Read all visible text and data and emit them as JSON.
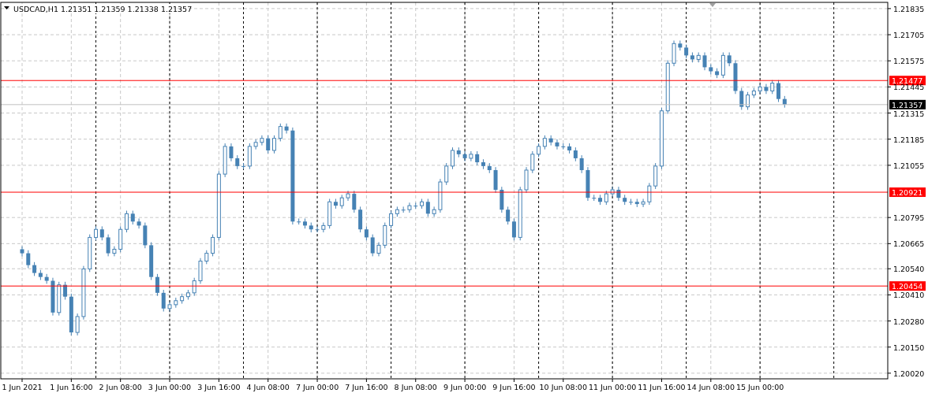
{
  "header": {
    "quotes": [
      "1.21351",
      "1.21359",
      "1.21338",
      "1.21357"
    ]
  },
  "chart_data": {
    "type": "candlestick",
    "grid": true,
    "title": "USDCAD,H1",
    "categories": [
      "1 Jun 2021",
      null,
      null,
      null,
      null,
      null,
      null,
      null,
      "1 Jun 16:00",
      null,
      null,
      null,
      null,
      null,
      null,
      null,
      "2 Jun 08:00",
      null,
      null,
      null,
      null,
      null,
      null,
      null,
      "3 Jun 00:00",
      null,
      null,
      null,
      null,
      null,
      null,
      null,
      "3 Jun 16:00",
      null,
      null,
      null,
      null,
      null,
      null,
      null,
      "4 Jun 08:00",
      null,
      null,
      null,
      null,
      null,
      null,
      null,
      "7 Jun 00:00",
      null,
      null,
      null,
      null,
      null,
      null,
      null,
      "7 Jun 16:00",
      null,
      null,
      null,
      null,
      null,
      null,
      null,
      "8 Jun 08:00",
      null,
      null,
      null,
      null,
      null,
      null,
      null,
      "9 Jun 00:00",
      null,
      null,
      null,
      null,
      null,
      null,
      null,
      "9 Jun 16:00",
      null,
      null,
      null,
      null,
      null,
      null,
      null,
      "10 Jun 08:00",
      null,
      null,
      null,
      null,
      null,
      null,
      null,
      "11 Jun 00:00",
      null,
      null,
      null,
      null,
      null,
      null,
      null,
      "11 Jun 16:00",
      null,
      null,
      null,
      null,
      null,
      null,
      null,
      "14 Jun 08:00",
      null,
      null,
      null,
      null,
      null,
      null,
      null,
      "15 Jun 00:00",
      null,
      null,
      null,
      null,
      null,
      null,
      null,
      null,
      null,
      null,
      null,
      null,
      null,
      null,
      null,
      null,
      null,
      null,
      null,
      null
    ],
    "ohlc": [
      [
        1.20637,
        1.20652,
        1.20602,
        1.20617
      ],
      [
        1.20617,
        1.20632,
        1.20543,
        1.20558
      ],
      [
        1.20558,
        1.20573,
        1.20504,
        1.20519
      ],
      [
        1.20519,
        1.20534,
        1.20484,
        1.20499
      ],
      [
        1.20499,
        1.20514,
        1.20465,
        1.2048
      ],
      [
        1.2048,
        1.20495,
        1.20307,
        1.20322
      ],
      [
        1.20322,
        1.20475,
        1.20307,
        1.2046
      ],
      [
        1.2046,
        1.20475,
        1.20386,
        1.20401
      ],
      [
        1.20401,
        1.20416,
        1.20208,
        1.20223
      ],
      [
        1.20223,
        1.20317,
        1.20208,
        1.20302
      ],
      [
        1.20302,
        1.20554,
        1.20287,
        1.20539
      ],
      [
        1.20539,
        1.20711,
        1.20524,
        1.20696
      ],
      [
        1.20696,
        1.20751,
        1.20681,
        1.20736
      ],
      [
        1.20736,
        1.20751,
        1.20681,
        1.20696
      ],
      [
        1.20696,
        1.20711,
        1.20602,
        1.20617
      ],
      [
        1.20617,
        1.20652,
        1.20602,
        1.20637
      ],
      [
        1.20637,
        1.20751,
        1.20622,
        1.20736
      ],
      [
        1.20736,
        1.20829,
        1.20721,
        1.20814
      ],
      [
        1.20814,
        1.20829,
        1.2076,
        1.20775
      ],
      [
        1.20775,
        1.2079,
        1.2074,
        1.20755
      ],
      [
        1.20755,
        1.2077,
        1.20642,
        1.20657
      ],
      [
        1.20657,
        1.20672,
        1.20484,
        1.20499
      ],
      [
        1.20499,
        1.20514,
        1.20405,
        1.2042
      ],
      [
        1.2042,
        1.20435,
        1.20327,
        1.20342
      ],
      [
        1.20342,
        1.20376,
        1.20327,
        1.20361
      ],
      [
        1.20361,
        1.20396,
        1.20346,
        1.20381
      ],
      [
        1.20381,
        1.20416,
        1.20366,
        1.20401
      ],
      [
        1.20401,
        1.20435,
        1.20386,
        1.2042
      ],
      [
        1.2042,
        1.20495,
        1.20405,
        1.2048
      ],
      [
        1.2048,
        1.20593,
        1.20465,
        1.20578
      ],
      [
        1.20578,
        1.20632,
        1.20563,
        1.20617
      ],
      [
        1.20617,
        1.20711,
        1.20602,
        1.20696
      ],
      [
        1.20696,
        1.21026,
        1.20681,
        1.21011
      ],
      [
        1.21011,
        1.21164,
        1.20996,
        1.21149
      ],
      [
        1.21149,
        1.21164,
        1.21075,
        1.2109
      ],
      [
        1.2109,
        1.21105,
        1.21036,
        1.21051
      ],
      [
        1.21051,
        1.21066,
        1.21036,
        1.21051
      ],
      [
        1.21051,
        1.21164,
        1.21036,
        1.21149
      ],
      [
        1.21149,
        1.21184,
        1.21134,
        1.21169
      ],
      [
        1.21169,
        1.21204,
        1.21154,
        1.21189
      ],
      [
        1.21189,
        1.21204,
        1.21114,
        1.21129
      ],
      [
        1.21129,
        1.21204,
        1.21114,
        1.21189
      ],
      [
        1.21189,
        1.21263,
        1.21174,
        1.21248
      ],
      [
        1.21248,
        1.21263,
        1.21213,
        1.21228
      ],
      [
        1.21228,
        1.21243,
        1.2076,
        1.20775
      ],
      [
        1.20775,
        1.2079,
        1.2076,
        1.20775
      ],
      [
        1.20775,
        1.2079,
        1.2074,
        1.20755
      ],
      [
        1.20755,
        1.2077,
        1.20721,
        1.20736
      ],
      [
        1.20736,
        1.20751,
        1.20721,
        1.20736
      ],
      [
        1.20736,
        1.2077,
        1.20721,
        1.20755
      ],
      [
        1.20755,
        1.20888,
        1.2074,
        1.20873
      ],
      [
        1.20873,
        1.20888,
        1.20839,
        1.20854
      ],
      [
        1.20854,
        1.20908,
        1.20839,
        1.20893
      ],
      [
        1.20893,
        1.20928,
        1.20878,
        1.20913
      ],
      [
        1.20913,
        1.20928,
        1.20819,
        1.20834
      ],
      [
        1.20834,
        1.20849,
        1.20721,
        1.20736
      ],
      [
        1.20736,
        1.20751,
        1.20681,
        1.20696
      ],
      [
        1.20696,
        1.20711,
        1.20602,
        1.20617
      ],
      [
        1.20617,
        1.20672,
        1.20602,
        1.20657
      ],
      [
        1.20657,
        1.2077,
        1.20642,
        1.20755
      ],
      [
        1.20755,
        1.20829,
        1.2074,
        1.20814
      ],
      [
        1.20814,
        1.20849,
        1.20799,
        1.20834
      ],
      [
        1.20834,
        1.20849,
        1.20819,
        1.20834
      ],
      [
        1.20834,
        1.20869,
        1.20819,
        1.20854
      ],
      [
        1.20854,
        1.20869,
        1.20839,
        1.20854
      ],
      [
        1.20854,
        1.20888,
        1.20839,
        1.20873
      ],
      [
        1.20873,
        1.20888,
        1.20799,
        1.20814
      ],
      [
        1.20814,
        1.20849,
        1.20799,
        1.20834
      ],
      [
        1.20834,
        1.20987,
        1.20819,
        1.20972
      ],
      [
        1.20972,
        1.21066,
        1.20957,
        1.21051
      ],
      [
        1.21051,
        1.21144,
        1.21036,
        1.21129
      ],
      [
        1.21129,
        1.21144,
        1.21095,
        1.2111
      ],
      [
        1.2111,
        1.21125,
        1.21075,
        1.2109
      ],
      [
        1.2109,
        1.21125,
        1.21075,
        1.2111
      ],
      [
        1.2111,
        1.21125,
        1.21055,
        1.2107
      ],
      [
        1.2107,
        1.21085,
        1.21036,
        1.21051
      ],
      [
        1.21051,
        1.21066,
        1.21016,
        1.21031
      ],
      [
        1.21031,
        1.21046,
        1.20918,
        1.20933
      ],
      [
        1.20933,
        1.20948,
        1.20819,
        1.20834
      ],
      [
        1.20834,
        1.20849,
        1.2076,
        1.20775
      ],
      [
        1.20775,
        1.2079,
        1.20681,
        1.20696
      ],
      [
        1.20696,
        1.20948,
        1.20681,
        1.20933
      ],
      [
        1.20933,
        1.21046,
        1.20918,
        1.21031
      ],
      [
        1.21031,
        1.21125,
        1.21016,
        1.2111
      ],
      [
        1.2111,
        1.21164,
        1.21095,
        1.21149
      ],
      [
        1.21149,
        1.21204,
        1.21134,
        1.21189
      ],
      [
        1.21189,
        1.21204,
        1.21154,
        1.21169
      ],
      [
        1.21169,
        1.21184,
        1.21134,
        1.21149
      ],
      [
        1.21149,
        1.21164,
        1.21134,
        1.21149
      ],
      [
        1.21149,
        1.21164,
        1.21114,
        1.21129
      ],
      [
        1.21129,
        1.21144,
        1.21075,
        1.2109
      ],
      [
        1.2109,
        1.21105,
        1.21016,
        1.21031
      ],
      [
        1.21031,
        1.21046,
        1.20878,
        1.20893
      ],
      [
        1.20893,
        1.20908,
        1.20878,
        1.20893
      ],
      [
        1.20893,
        1.20908,
        1.20858,
        1.20873
      ],
      [
        1.20873,
        1.20928,
        1.20858,
        1.20913
      ],
      [
        1.20913,
        1.20948,
        1.20898,
        1.20933
      ],
      [
        1.20933,
        1.20948,
        1.20878,
        1.20893
      ],
      [
        1.20893,
        1.20908,
        1.20858,
        1.20873
      ],
      [
        1.20873,
        1.20888,
        1.20858,
        1.20873
      ],
      [
        1.20873,
        1.20888,
        1.20847,
        1.20862
      ],
      [
        1.20862,
        1.20888,
        1.20847,
        1.20873
      ],
      [
        1.20873,
        1.20967,
        1.20858,
        1.20952
      ],
      [
        1.20952,
        1.21066,
        1.20937,
        1.21051
      ],
      [
        1.21051,
        1.21341,
        1.21036,
        1.21326
      ],
      [
        1.21326,
        1.21578,
        1.21311,
        1.21563
      ],
      [
        1.21563,
        1.21676,
        1.21548,
        1.21661
      ],
      [
        1.21661,
        1.21676,
        1.21626,
        1.21641
      ],
      [
        1.21641,
        1.21656,
        1.21587,
        1.21602
      ],
      [
        1.21602,
        1.21617,
        1.21567,
        1.21582
      ],
      [
        1.21582,
        1.21617,
        1.21567,
        1.21602
      ],
      [
        1.21602,
        1.21617,
        1.21528,
        1.21543
      ],
      [
        1.21543,
        1.21558,
        1.21508,
        1.21523
      ],
      [
        1.21523,
        1.21538,
        1.21489,
        1.21504
      ],
      [
        1.21504,
        1.21617,
        1.21489,
        1.21602
      ],
      [
        1.21602,
        1.21617,
        1.21548,
        1.21563
      ],
      [
        1.21563,
        1.21578,
        1.2141,
        1.21425
      ],
      [
        1.21425,
        1.2144,
        1.21331,
        1.21346
      ],
      [
        1.21346,
        1.2142,
        1.21331,
        1.21405
      ],
      [
        1.21405,
        1.2144,
        1.2139,
        1.21425
      ],
      [
        1.21425,
        1.2146,
        1.2141,
        1.21445
      ],
      [
        1.21445,
        1.2146,
        1.2141,
        1.21425
      ],
      [
        1.21425,
        1.21479,
        1.2141,
        1.21464
      ],
      [
        1.21464,
        1.21479,
        1.2137,
        1.21385
      ],
      [
        1.21385,
        1.214,
        1.21342,
        1.21357
      ],
      null,
      null,
      null,
      null,
      null,
      null,
      null,
      null,
      null,
      null,
      null,
      null,
      null,
      null,
      null,
      null
    ],
    "ylim": [
      1.19992,
      1.21866
    ],
    "yticks": [
      {
        "value": 1.21835,
        "label": "1.21835"
      },
      {
        "value": 1.21705,
        "label": "1.21705"
      },
      {
        "value": 1.21575,
        "label": "1.21575"
      },
      {
        "value": 1.21445,
        "label": "1.21445"
      },
      {
        "value": 1.21315,
        "label": "1.21315"
      },
      {
        "value": 1.21185,
        "label": "1.21185"
      },
      {
        "value": 1.21055,
        "label": "1.21055"
      },
      {
        "value": 1.20795,
        "label": "1.20795"
      },
      {
        "value": 1.20665,
        "label": "1.20665"
      },
      {
        "value": 1.2054,
        "label": "1.20540"
      },
      {
        "value": 1.2041,
        "label": "1.20410"
      },
      {
        "value": 1.2028,
        "label": "1.20280"
      },
      {
        "value": 1.2015,
        "label": "1.20150"
      },
      {
        "value": 1.2002,
        "label": "1.20020"
      }
    ],
    "ref_lines": [
      {
        "axis": "y",
        "value": 1.21477,
        "label": "1.21477",
        "color": "#ff0000"
      },
      {
        "axis": "y",
        "value": 1.21357,
        "label": "1.21357",
        "color": "#c0c0c0"
      },
      {
        "axis": "y",
        "value": 1.20921,
        "label": "1.20921",
        "color": "#ff0000"
      },
      {
        "axis": "y",
        "value": 1.20454,
        "label": "1.20454",
        "color": "#ff0000"
      }
    ]
  }
}
